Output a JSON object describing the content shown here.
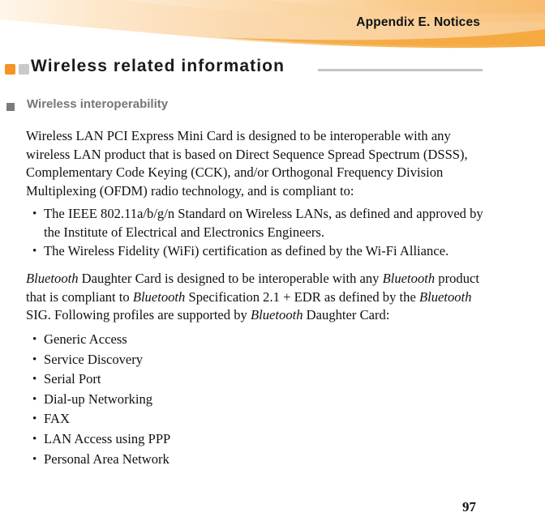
{
  "header": {
    "title": "Appendix E. Notices",
    "colors": {
      "band_light": "#fdf0de",
      "band_mid": "#fbddb4",
      "band_deep": "#f9c77f",
      "band_accent": "#f5a93f",
      "band_edge": "#f59324"
    }
  },
  "section": {
    "title": "Wireless related information",
    "marker_orange_color": "#f59324",
    "marker_gray_color": "#c9c9c9",
    "rule_color": "#c4c4c4"
  },
  "subheading": {
    "text": "Wireless interoperability",
    "color": "#767676"
  },
  "body": {
    "paragraph_1": "Wireless LAN PCI Express Mini Card is designed to be interoperable with any wireless LAN product that is based on Direct Sequence Spread Spectrum (DSSS), Complementary Code Keying (CCK), and/or Orthogonal Frequency Division Multiplexing (OFDM) radio technology, and is compliant to:",
    "standards_list": [
      "The IEEE 802.11a/b/g/n Standard on Wireless LANs, as defined and approved by the Institute of Electrical and Electronics Engineers.",
      "The Wireless Fidelity (WiFi) certification as defined by the Wi-Fi Alliance."
    ],
    "bluetooth_paragraph": {
      "seg_1_italic": "Bluetooth",
      "seg_2": " Daughter Card is designed to be interoperable with any ",
      "seg_3_italic": "Bluetooth",
      "seg_4": " product that is compliant to ",
      "seg_5_italic": "Bluetooth",
      "seg_6": " Specification 2.1 + EDR as defined by the ",
      "seg_7_italic": "Bluetooth",
      "seg_8": " SIG. Following profiles are supported by ",
      "seg_9_italic": "Bluetooth",
      "seg_10": " Daughter Card:"
    },
    "profiles_list": [
      "Generic Access",
      "Service Discovery",
      "Serial Port",
      "Dial-up Networking",
      "FAX",
      "LAN Access using PPP",
      "Personal Area Network"
    ]
  },
  "footer": {
    "page_number": "97"
  }
}
